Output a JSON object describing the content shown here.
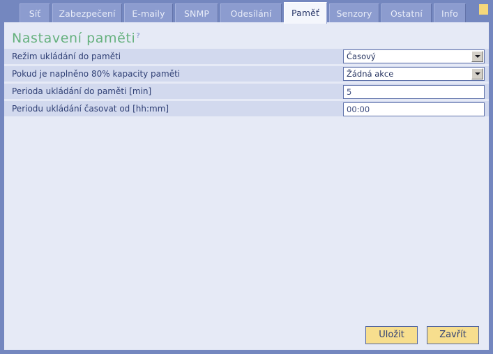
{
  "tabs": [
    {
      "label": "Síť",
      "active": false
    },
    {
      "label": "Zabezpečení",
      "active": false
    },
    {
      "label": "E-maily",
      "active": false
    },
    {
      "label": "SNMP",
      "active": false
    },
    {
      "label": "Odesílání",
      "active": false
    },
    {
      "label": "Paměť",
      "active": true
    },
    {
      "label": "Senzory",
      "active": false
    },
    {
      "label": "Ostatní",
      "active": false
    },
    {
      "label": "Info",
      "active": false
    }
  ],
  "page": {
    "title": "Nastavení paměti",
    "help_mark": "?"
  },
  "form": {
    "rows": [
      {
        "label": "Režim ukládání do paměti",
        "type": "select",
        "value": "Časový"
      },
      {
        "label": "Pokud je naplněno 80% kapacity paměti",
        "type": "select",
        "value": "Žádná akce"
      },
      {
        "label": "Perioda ukládání do paměti [min]",
        "type": "input",
        "value": "5",
        "placeholder": ""
      },
      {
        "label": "Periodu ukládání časovat od [hh:mm]",
        "type": "input",
        "value": "00:00",
        "placeholder": ""
      }
    ]
  },
  "footer": {
    "save_label": "Uložit",
    "close_label": "Zavřít"
  },
  "colors": {
    "frame": "#7487bf",
    "tab_inactive": "#8c9ccf",
    "tab_active": "#f4f6fc",
    "panel_bg": "#e6eaf6",
    "row_bg": "#d2d9ee",
    "title_green": "#66b17e",
    "button_yellow": "#f7de8e",
    "indicator_yellow": "#f5d77a",
    "text_blue": "#2f3f74"
  }
}
